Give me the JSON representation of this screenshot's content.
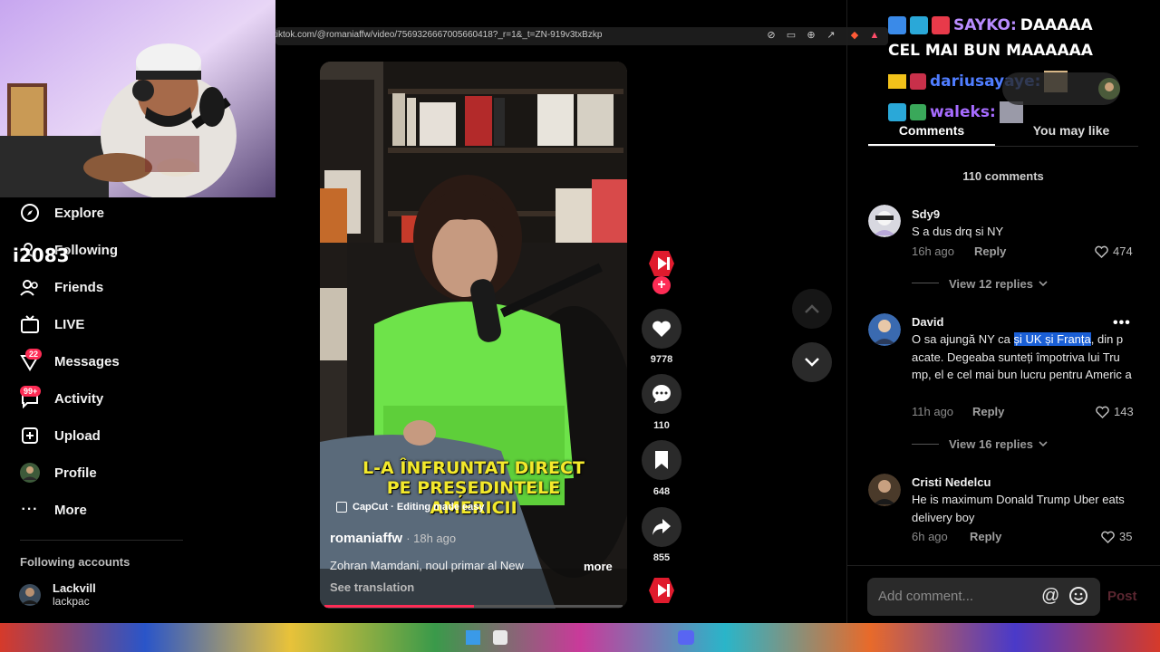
{
  "browser": {
    "url": "tiktok.com/@romaniaffw/video/7569326667005660418?_r=1&_t=ZN-919v3txBzkp"
  },
  "sidebar": {
    "items": [
      {
        "label": "Explore",
        "icon": "compass-icon"
      },
      {
        "label": "Following",
        "icon": "following-icon"
      },
      {
        "label": "Friends",
        "icon": "friends-icon"
      },
      {
        "label": "LIVE",
        "icon": "live-icon"
      },
      {
        "label": "Messages",
        "icon": "messages-icon",
        "badge": "22"
      },
      {
        "label": "Activity",
        "icon": "activity-icon",
        "badge": "99+"
      },
      {
        "label": "Upload",
        "icon": "upload-icon"
      },
      {
        "label": "Profile",
        "icon": "profile-icon"
      },
      {
        "label": "More",
        "icon": "more-icon"
      }
    ],
    "following_title": "Following accounts",
    "following": [
      {
        "name": "Lackvill",
        "handle": "lackpac"
      }
    ],
    "overlay_text": "i2083"
  },
  "video": {
    "caption_lines": [
      "L-A ÎNFRUNTAT DIRECT",
      "PE PREȘEDINTELE",
      "AMERICII"
    ],
    "capcut": "CapCut · Editing made easy",
    "author": "romaniaffw",
    "time": "· 18h ago",
    "description": "Zohran Mamdani, noul primar al New",
    "more": "more",
    "see_translation": "See translation",
    "progress": 0.5
  },
  "actions": {
    "likes": "9778",
    "comments": "110",
    "saves": "648",
    "shares": "855"
  },
  "panel": {
    "tabs": [
      "Comments",
      "You may like"
    ],
    "comment_count": "110 comments",
    "comments": [
      {
        "name": "Sdy9",
        "text": "S a dus drq si NY",
        "time": "16h ago",
        "reply": "Reply",
        "likes": "474",
        "view_replies": "View 12 replies"
      },
      {
        "name": "David",
        "text_before": "O sa ajungă NY ca ",
        "text_highlight": "și UK și Franța",
        "text_after": ", din p acate. Degeaba sunteți împotriva lui Tru mp, el e cel mai bun lucru pentru Americ a",
        "time": "11h ago",
        "reply": "Reply",
        "likes": "143",
        "view_replies": "View 16 replies"
      },
      {
        "name": "Cristi Nedelcu",
        "text": "He is maximum Donald Trump Uber eats delivery boy",
        "time": "6h ago",
        "reply": "Reply",
        "likes": "35"
      }
    ],
    "add_comment_placeholder": "Add comment...",
    "post": "Post"
  },
  "chat": {
    "lines": [
      {
        "user": "SAYKO:",
        "message": "DAAAAA",
        "user_color": "#b98cff"
      },
      {
        "user": "",
        "message": "CEL MAI BUN MAAAAAA",
        "user_color": "#ffffff"
      },
      {
        "user": "dariusayaye:",
        "message": "",
        "user_color": "#4f7dff"
      },
      {
        "user": "waleks:",
        "message": "",
        "user_color": "#a66bff"
      }
    ]
  },
  "colors": {
    "accent": "#fe2c55",
    "caption": "#f3e92b",
    "highlight": "#1a5fd6"
  }
}
